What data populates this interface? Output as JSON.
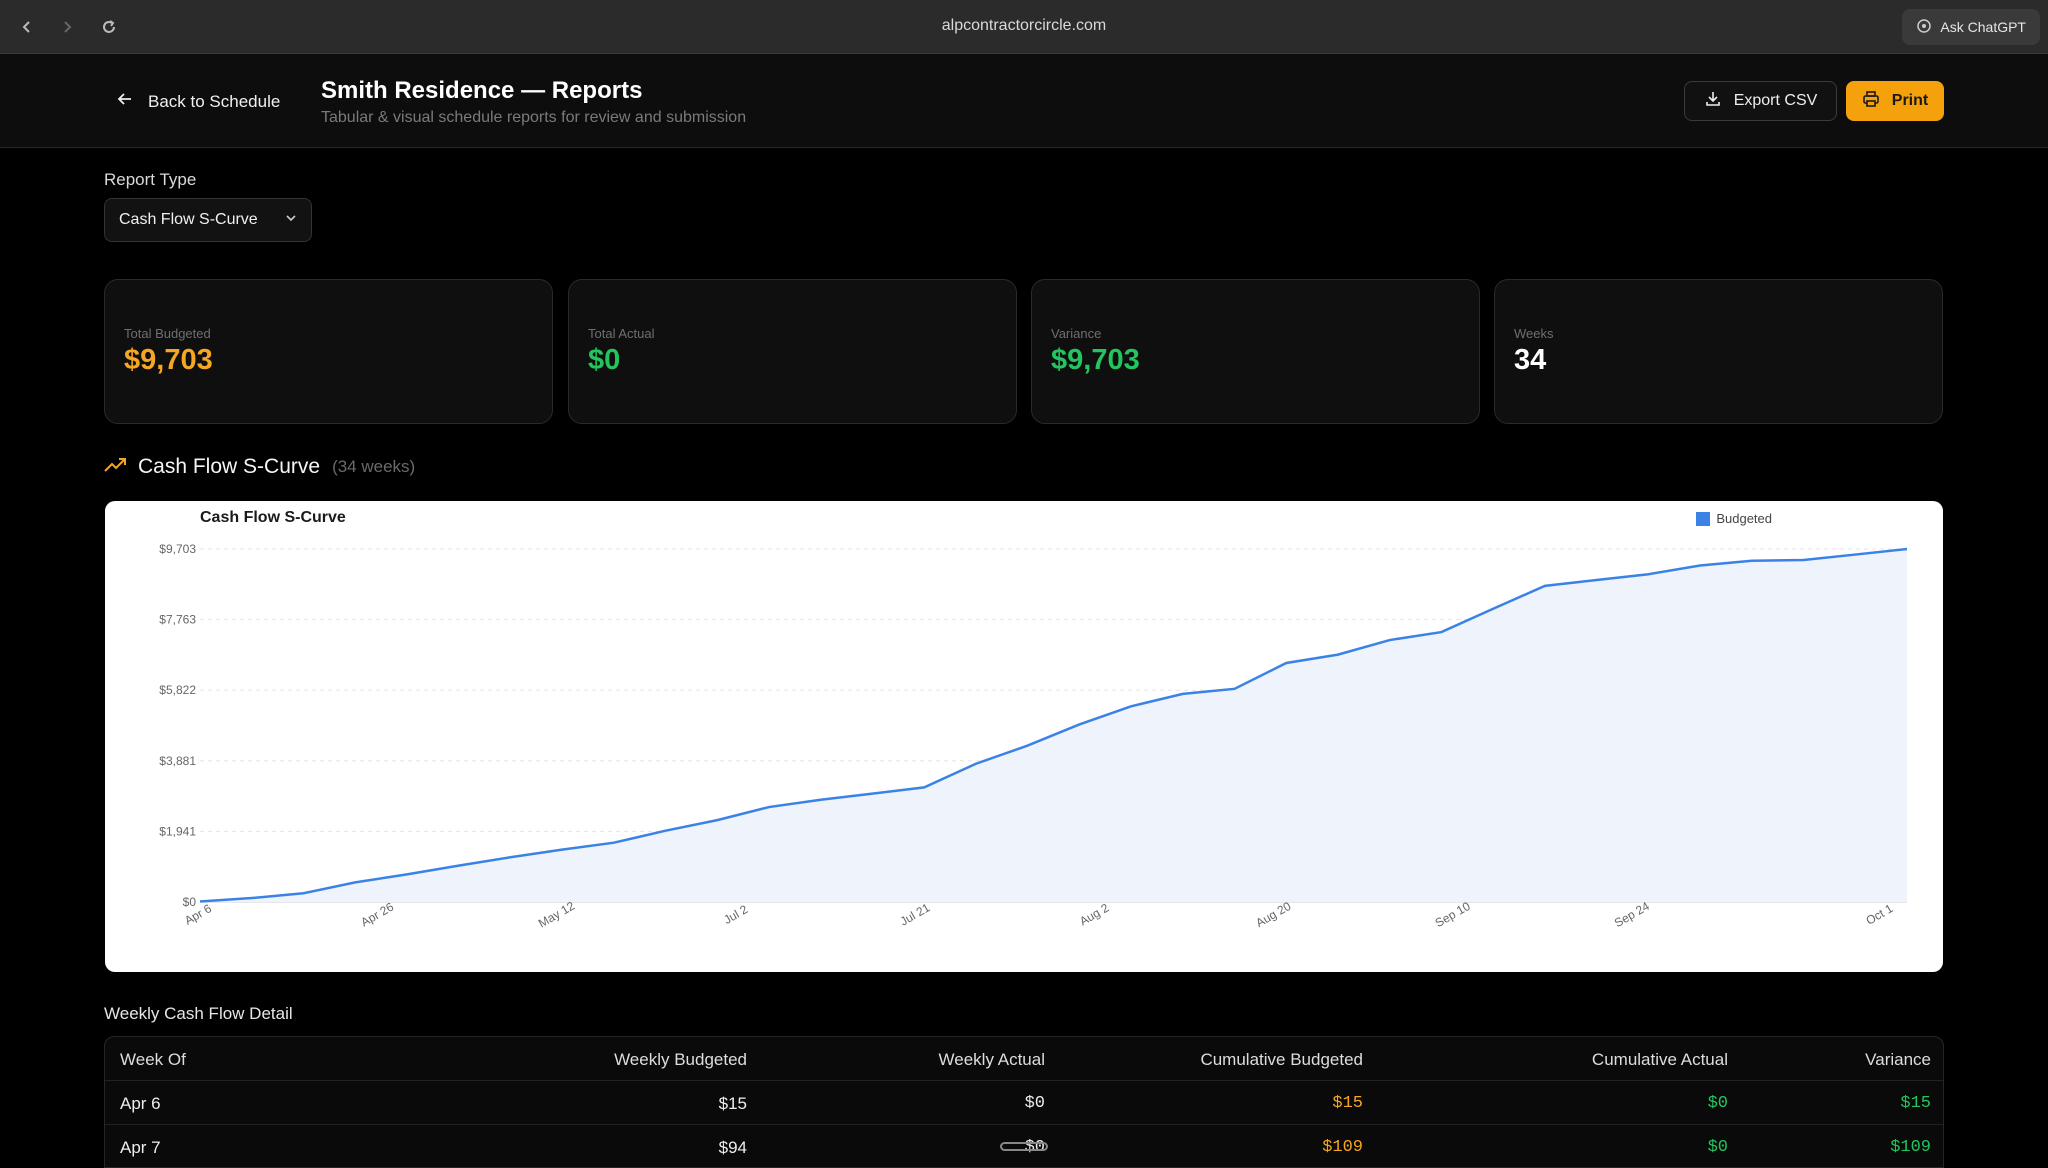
{
  "browser": {
    "url": "alpcontractorcircle.com",
    "ask_label": "Ask ChatGPT"
  },
  "header": {
    "back_label": "Back to Schedule",
    "title": "Smith Residence — Reports",
    "subtitle": "Tabular & visual schedule reports for review and submission",
    "export_label": "Export CSV",
    "print_label": "Print"
  },
  "report_type": {
    "label": "Report Type",
    "selected": "Cash Flow S-Curve"
  },
  "stats": [
    {
      "label": "Total Budgeted",
      "value": "$9,703",
      "color": "#f5a623"
    },
    {
      "label": "Total Actual",
      "value": "$0",
      "color": "#22c55e"
    },
    {
      "label": "Variance",
      "value": "$9,703",
      "color": "#22c55e"
    },
    {
      "label": "Weeks",
      "value": "34",
      "color": "#ffffff"
    }
  ],
  "section": {
    "title": "Cash Flow S-Curve",
    "subtitle": "(34 weeks)"
  },
  "chart_data": {
    "type": "area",
    "title": "Cash Flow S-Curve",
    "series": [
      {
        "name": "Budgeted",
        "color": "#3b82e6",
        "values": [
          15,
          109,
          240,
          540,
          760,
          1000,
          1230,
          1440,
          1630,
          1960,
          2250,
          2610,
          2810,
          2980,
          3150,
          3800,
          4300,
          4880,
          5380,
          5720,
          5860,
          6570,
          6800,
          7200,
          7420,
          8060,
          8690,
          8850,
          9010,
          9250,
          9380,
          9400,
          9550,
          9703
        ]
      }
    ],
    "x_tick_labels": [
      "Apr 6",
      "Apr 26",
      "May 12",
      "Jul 2",
      "Jul 21",
      "Aug 2",
      "Aug 20",
      "Sep 10",
      "Sep 24",
      "Oct 1"
    ],
    "y_tick_labels": [
      "$0",
      "$1,941",
      "$3,881",
      "$5,822",
      "$7,763",
      "$9,703"
    ],
    "ylim": [
      0,
      9703
    ],
    "grid": true,
    "legend_position": "top-right"
  },
  "table": {
    "title": "Weekly Cash Flow Detail",
    "columns": [
      "Week Of",
      "Weekly Budgeted",
      "Weekly Actual",
      "Cumulative Budgeted",
      "Cumulative Actual",
      "Variance"
    ],
    "rows": [
      [
        "Apr 6",
        "$15",
        "$0",
        "$15",
        "$0",
        "$15"
      ],
      [
        "Apr 7",
        "$94",
        "$0",
        "$109",
        "$0",
        "$109"
      ]
    ],
    "colors": {
      "cumulative_budgeted": "#f5a623",
      "cumulative_actual": "#22c55e",
      "variance": "#22c55e"
    }
  }
}
